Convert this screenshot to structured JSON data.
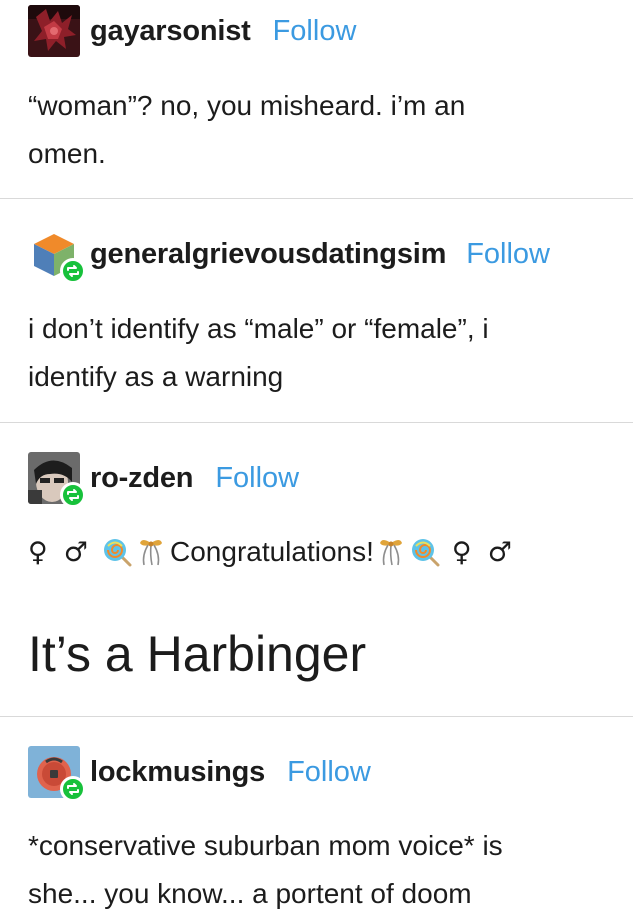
{
  "posts": [
    {
      "username": "gayarsonist",
      "follow_label": "Follow",
      "lines": [
        "“woman”? no, you misheard. i’m an",
        "omen."
      ]
    },
    {
      "username": "generalgrievousdatingsim",
      "follow_label": "Follow",
      "lines": [
        "i don’t identify as “male” or “female”, i",
        "identify as a warning"
      ]
    },
    {
      "username": "ro-zden",
      "follow_label": "Follow",
      "congrats_text": "Congratulations!",
      "female_symbol": "♀",
      "male_symbol": "♂",
      "heading": "It’s a Harbinger"
    },
    {
      "username": "lockmusings",
      "follow_label": "Follow",
      "lines": [
        "*conservative suburban mom voice* is",
        "she... you know... a portent of doom"
      ]
    }
  ],
  "icons": {
    "reblog_badge": "reblog-icon",
    "lollipop": "lollipop-icon",
    "ribbon": "ribbon-icon"
  },
  "colors": {
    "follow": "#3b9ae1",
    "reblog_badge": "#17c13b",
    "divider": "#d9d9d9",
    "text": "#1c1c1c"
  }
}
